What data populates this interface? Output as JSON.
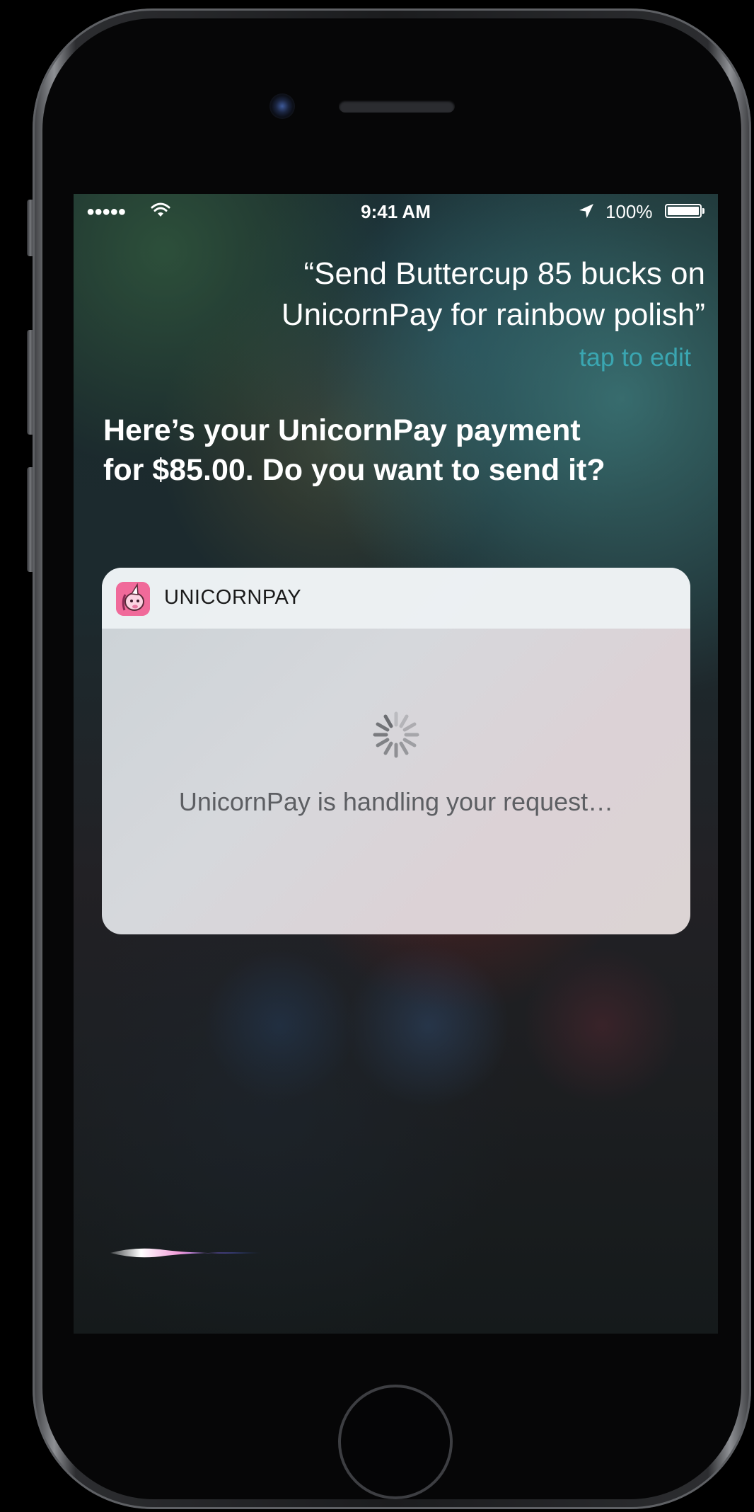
{
  "status_bar": {
    "signal": "●●●●●",
    "time": "9:41 AM",
    "battery_percent": "100%",
    "battery_level": 1.0
  },
  "siri": {
    "query": "“Send Buttercup 85 bucks on UnicornPay for rainbow polish”",
    "tap_to_edit": "tap to edit",
    "response": "Here’s your UnicornPay payment for $85.00. Do you want to send it?"
  },
  "card": {
    "app_name": "UNICORNPAY",
    "status_text": "UnicornPay is handling your request…"
  },
  "colors": {
    "tap_to_edit": "#3aa6b1",
    "app_icon": "#f06a9a",
    "card_status_text": "#5d5f63"
  },
  "icons": {
    "wifi": "wifi-icon",
    "location": "location-arrow-icon",
    "battery": "battery-icon",
    "app": "unicorn-app-icon",
    "spinner": "loading-spinner-icon",
    "siri": "siri-waveform-icon"
  }
}
